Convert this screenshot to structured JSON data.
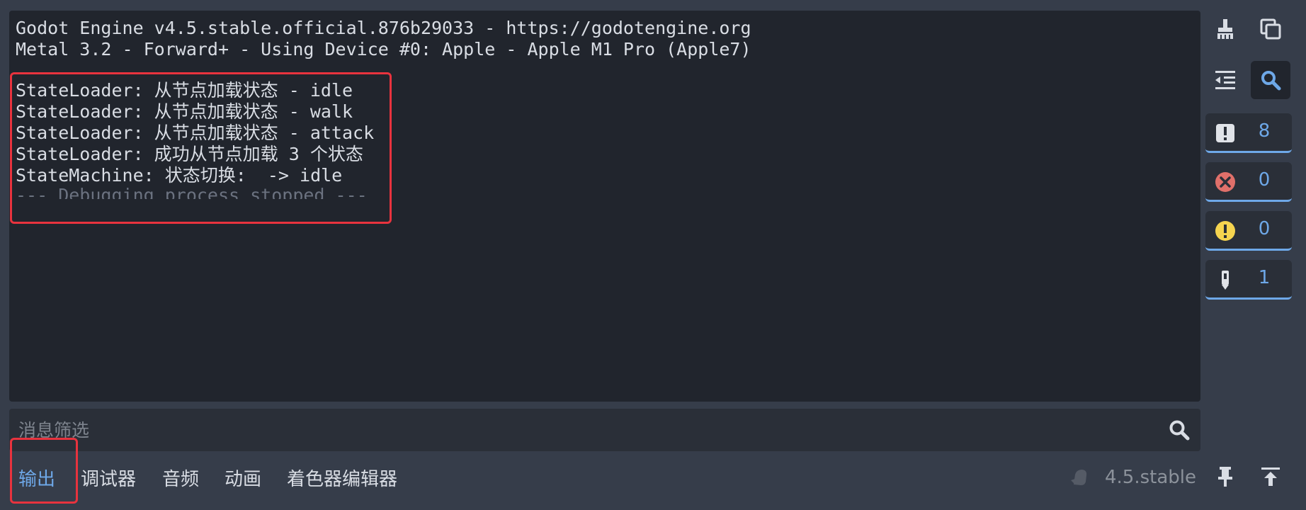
{
  "console": {
    "lines": [
      "Godot Engine v4.5.stable.official.876b29033 - https://godotengine.org",
      "Metal 3.2 - Forward+ - Using Device #0: Apple - Apple M1 Pro (Apple7)",
      "StateLoader: 从节点加载状态 - idle",
      "StateLoader: 从节点加载状态 - walk",
      "StateLoader: 从节点加载状态 - attack",
      "StateLoader: 成功从节点加载 3 个状态",
      "StateMachine: 状态切换:  -> idle",
      "--- Debugging process stopped ---"
    ]
  },
  "counters": {
    "messages": "8",
    "errors": "0",
    "warnings": "0",
    "editor": "1"
  },
  "filter": {
    "placeholder": "消息筛选"
  },
  "tabs": [
    "输出",
    "调试器",
    "音频",
    "动画",
    "着色器编辑器"
  ],
  "status": {
    "version": "4.5.stable"
  },
  "colors": {
    "accent": "#6ea8e8",
    "error": "#e0706a",
    "warning": "#f5d44f",
    "highlight": "#e8333e"
  },
  "icons": {
    "clear": "broom-icon",
    "copy": "copy-icon",
    "collapse": "collapse-duplicates-icon",
    "search": "search-icon",
    "messages": "message-icon",
    "errors": "error-icon",
    "warnings": "warning-icon",
    "editor": "editor-message-icon",
    "pin": "pin-icon",
    "expand": "expand-panel-icon",
    "update": "update-spinner-icon"
  }
}
